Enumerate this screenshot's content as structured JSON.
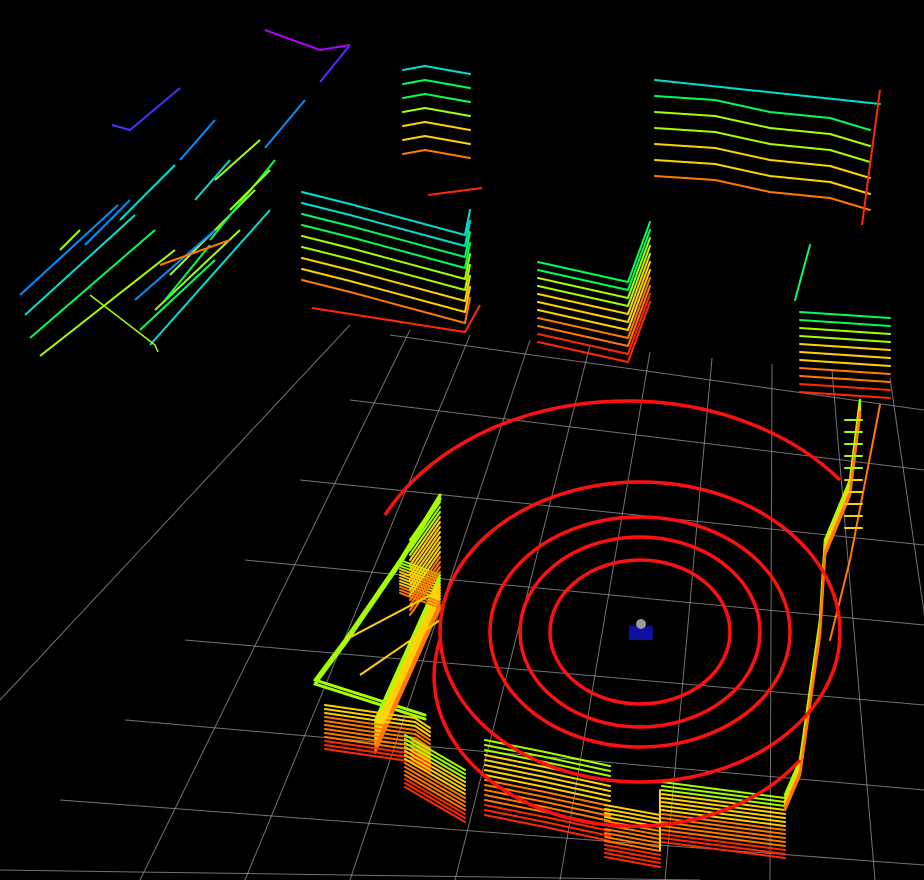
{
  "viewer": {
    "background": "#000000",
    "grid": {
      "visible": true,
      "color": "#9a9a9a"
    },
    "robot": {
      "body_color": "#1010a0",
      "sensor_color": "#9a9a9a"
    },
    "rings": {
      "count": 5,
      "color": "#ff1010"
    },
    "colormap": [
      "#ff2a00",
      "#ff7a00",
      "#ffd200",
      "#a6ff00",
      "#00ff55",
      "#00e0d0",
      "#0090ff",
      "#5a28ff",
      "#b400ff"
    ]
  }
}
